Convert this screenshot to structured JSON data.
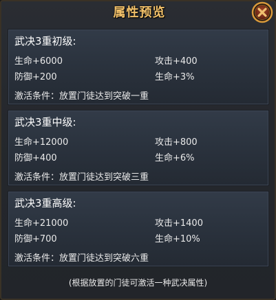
{
  "title": "属性预览",
  "cards": [
    {
      "title": "武决3重初级:",
      "stat_hp": "生命+6000",
      "stat_atk": "攻击+400",
      "stat_def": "防御+200",
      "stat_hp_pct": "生命+3%",
      "condition": "激活条件：放置门徒达到突破一重"
    },
    {
      "title": "武决3重中级:",
      "stat_hp": "生命+12000",
      "stat_atk": "攻击+800",
      "stat_def": "防御+400",
      "stat_hp_pct": "生命+6%",
      "condition": "激活条件：放置门徒达到突破三重"
    },
    {
      "title": "武决3重高级:",
      "stat_hp": "生命+21000",
      "stat_atk": "攻击+1400",
      "stat_def": "防御+700",
      "stat_hp_pct": "生命+10%",
      "condition": "激活条件：放置门徒达到突破六重"
    }
  ],
  "footer": "(根据放置的门徒可激活一种武决属性)",
  "colors": {
    "title": "#f2c16a",
    "close_ring": "#d99a3a",
    "close_fill": "#7a2a1a"
  },
  "icons": {
    "close": "close-icon"
  }
}
